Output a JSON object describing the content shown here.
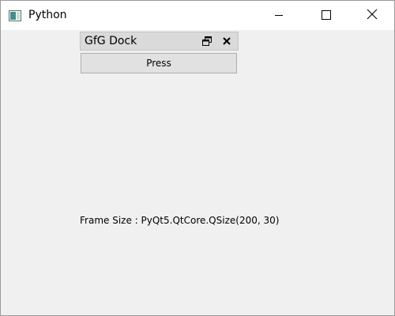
{
  "window": {
    "title": "Python",
    "icon": "python-app-icon",
    "controls": [
      "minimize-icon",
      "maximize-icon",
      "close-icon"
    ]
  },
  "dock": {
    "title": "GfG Dock",
    "float_icon": "float-icon",
    "close_icon": "close-icon",
    "button_label": "Press"
  },
  "label": {
    "text": "Frame Size : PyQt5.QtCore.QSize(200, 30)"
  },
  "colors": {
    "window_bg": "#f0f0f0",
    "titlebar_bg": "#ffffff",
    "dock_title_bg": "#dadada",
    "button_bg": "#e1e1e1",
    "button_border": "#adadad"
  }
}
